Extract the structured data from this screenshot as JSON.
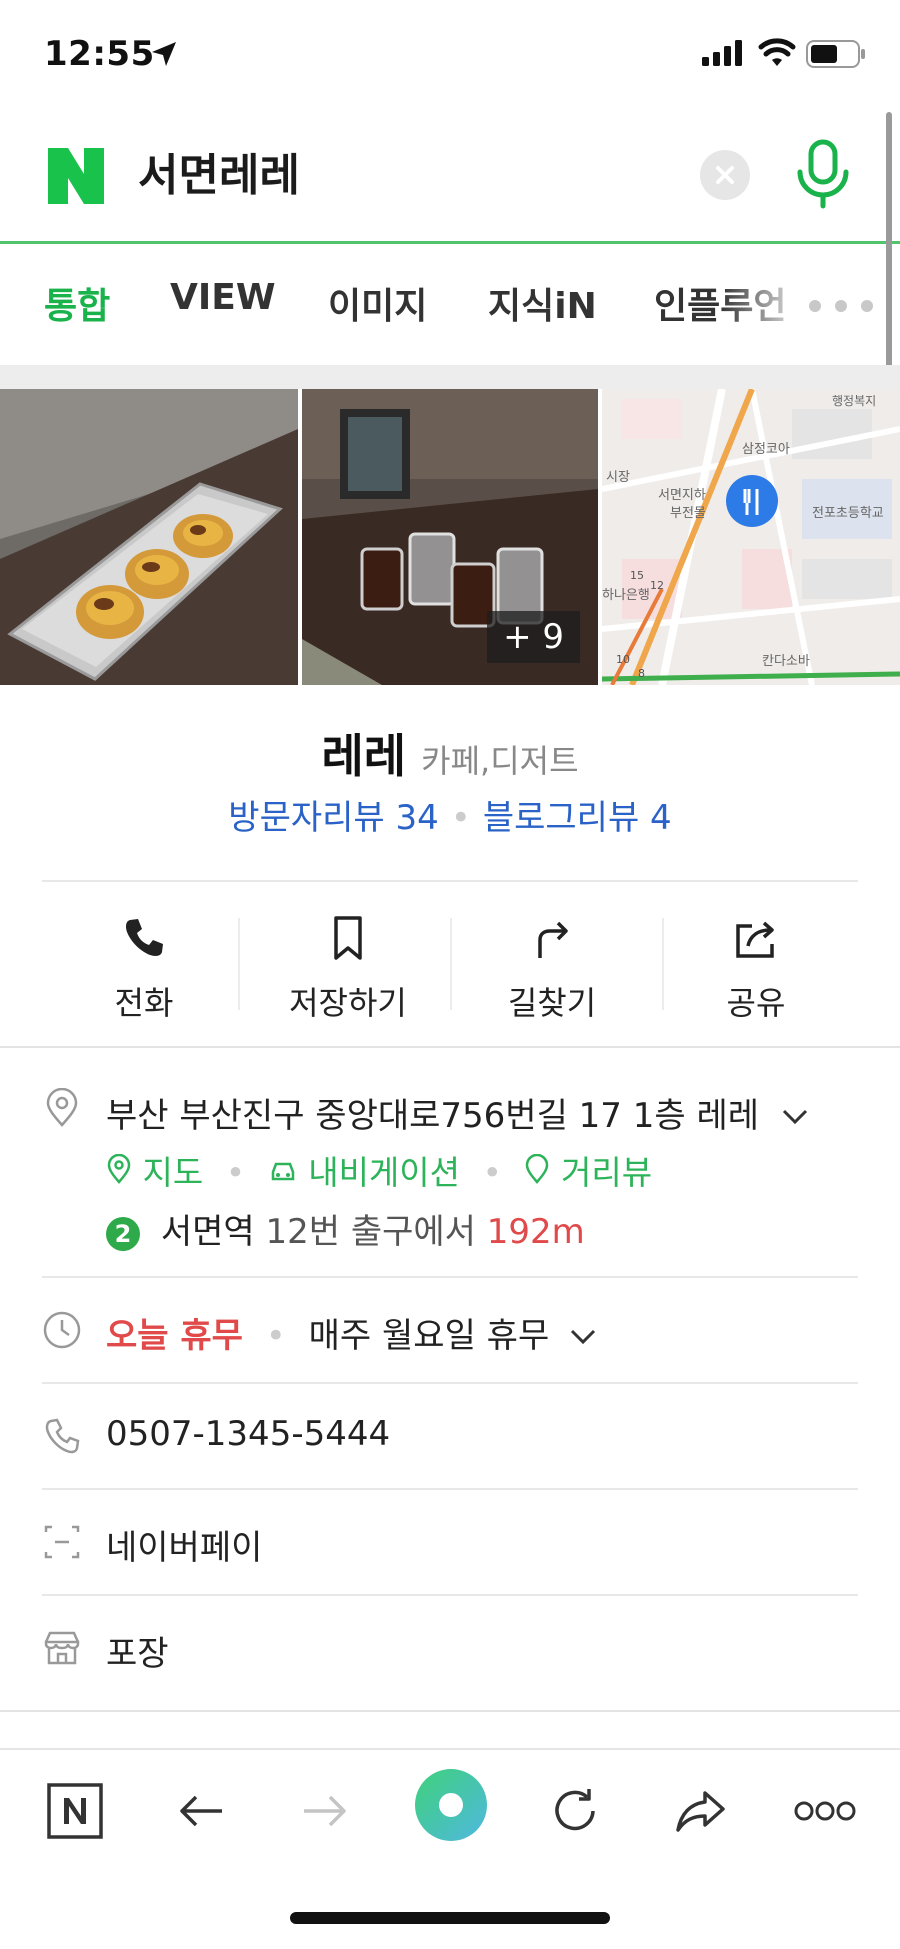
{
  "status_bar": {
    "time": "12:55",
    "icons": [
      "location-arrow-icon",
      "signal-icon",
      "wifi-icon",
      "battery-icon"
    ]
  },
  "search": {
    "logo": "N",
    "query": "서면레레",
    "icons": [
      "clear-icon",
      "microphone-icon"
    ]
  },
  "tabs": [
    {
      "label": "통합",
      "active": true
    },
    {
      "label": "VIEW",
      "active": false
    },
    {
      "label": "이미지",
      "active": false
    },
    {
      "label": "지식iN",
      "active": false
    },
    {
      "label": "인플루언",
      "active": false
    }
  ],
  "photos": {
    "more_count": "+ 9",
    "map_labels": [
      "행정복지",
      "삼정코아",
      "시장",
      "서면지하",
      "부전몰",
      "전포초등학교",
      "하나은행",
      "칸다소바",
      "15",
      "12",
      "10",
      "8"
    ]
  },
  "place": {
    "name": "레레",
    "category": "카페,디저트",
    "visitor_review": "방문자리뷰 34",
    "blog_review": "블로그리뷰 4"
  },
  "actions": [
    {
      "label": "전화",
      "icon": "phone-icon"
    },
    {
      "label": "저장하기",
      "icon": "bookmark-icon"
    },
    {
      "label": "길찾기",
      "icon": "directions-icon"
    },
    {
      "label": "공유",
      "icon": "share-icon"
    }
  ],
  "address": {
    "text": "부산 부산진구 중앙대로756번길 17 1층 레레",
    "links": [
      "지도",
      "내비게이션",
      "거리뷰"
    ],
    "subway_line": "2",
    "station": "서면역",
    "exit_text": "12번 출구에서",
    "distance": "192m"
  },
  "hours": {
    "status": "오늘 휴무",
    "detail": "매주 월요일 휴무"
  },
  "phone": "0507-1345-5444",
  "payment": "네이버페이",
  "takeout": "포장",
  "colors": {
    "naver_green": "#19b24b",
    "link_blue": "#2a62c7",
    "alert_red": "#e04a4a"
  }
}
